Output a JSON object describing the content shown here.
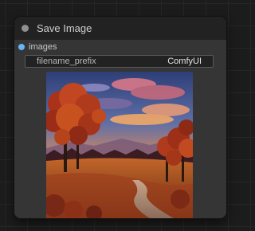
{
  "node": {
    "title": "Save Image",
    "input": {
      "label": "images",
      "color": "#64b5f6"
    },
    "widget": {
      "label": "filename_prefix",
      "value": "ComfyUI"
    }
  },
  "preview_image": {
    "description_icon": "autumn-landscape-image"
  }
}
